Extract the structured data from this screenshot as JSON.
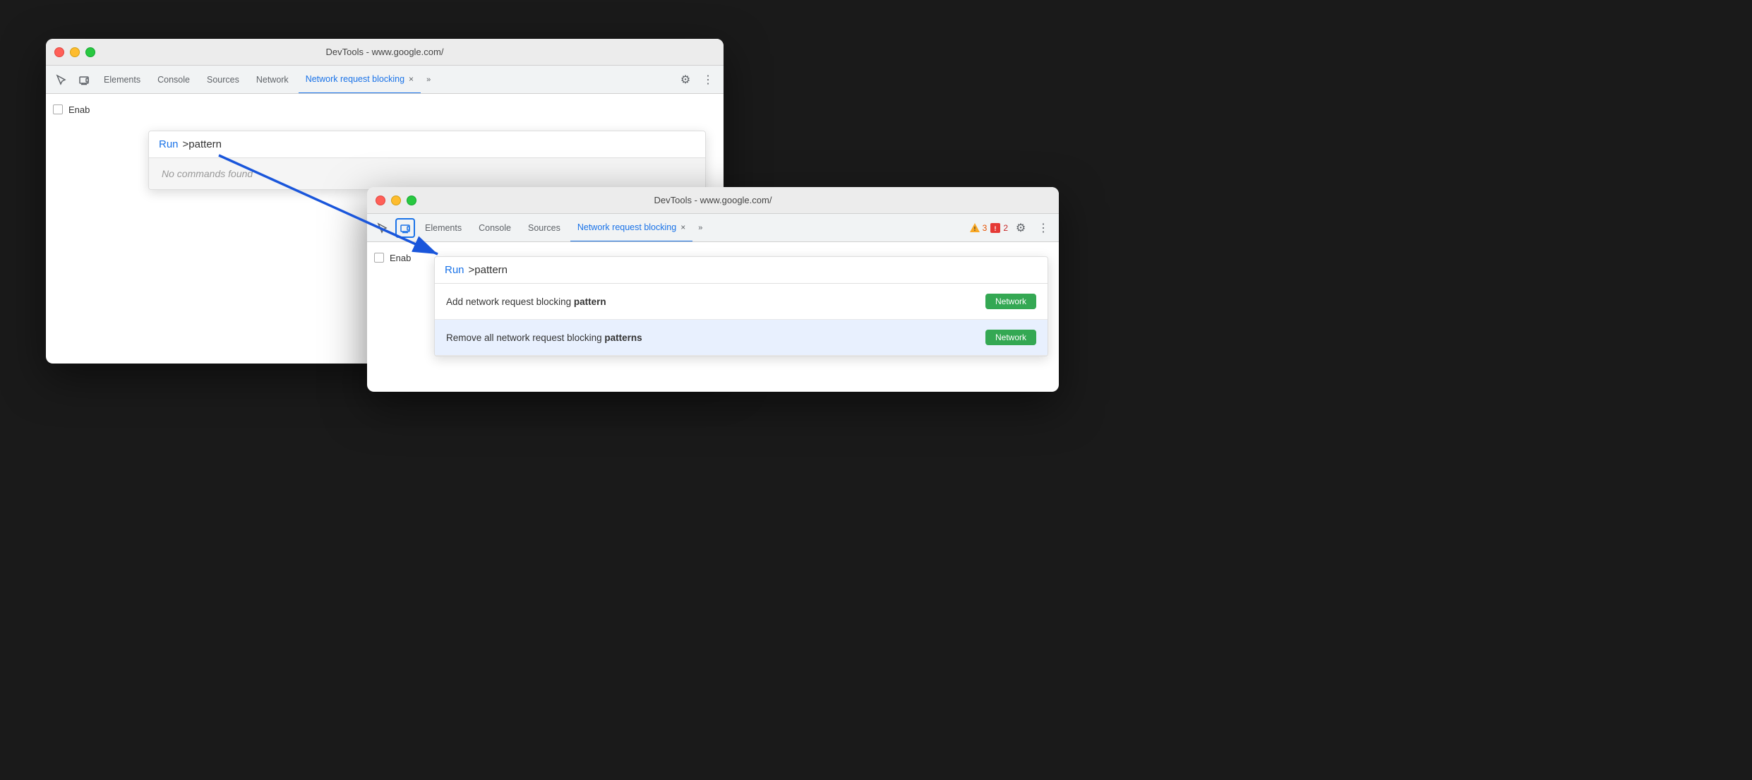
{
  "window1": {
    "title": "DevTools - www.google.com/",
    "tabs": [
      {
        "label": "Elements",
        "active": false
      },
      {
        "label": "Console",
        "active": false
      },
      {
        "label": "Sources",
        "active": false
      },
      {
        "label": "Network",
        "active": false
      },
      {
        "label": "Network request blocking",
        "active": true
      }
    ],
    "commandPalette": {
      "runLabel": "Run",
      "inputText": ">pattern",
      "noResults": "No commands found"
    },
    "content": {
      "checkboxLabel": "Enab"
    }
  },
  "window2": {
    "title": "DevTools - www.google.com/",
    "tabs": [
      {
        "label": "Elements",
        "active": false
      },
      {
        "label": "Console",
        "active": false
      },
      {
        "label": "Sources",
        "active": false
      },
      {
        "label": "Network request blocking",
        "active": true
      }
    ],
    "warningCount": "3",
    "errorCount": "2",
    "commandPalette": {
      "runLabel": "Run",
      "inputText": ">pattern",
      "results": [
        {
          "text": "Add network request blocking ",
          "bold": "pattern",
          "category": "Network",
          "highlighted": false
        },
        {
          "text": "Remove all network request blocking ",
          "bold": "patterns",
          "suffix": "",
          "category": "Network",
          "highlighted": true
        }
      ]
    },
    "content": {
      "checkboxLabel": "Enab"
    }
  },
  "icons": {
    "inspect": "⊹",
    "device": "▭",
    "settings": "⚙",
    "more": "⋮",
    "moreTabs": "»"
  }
}
